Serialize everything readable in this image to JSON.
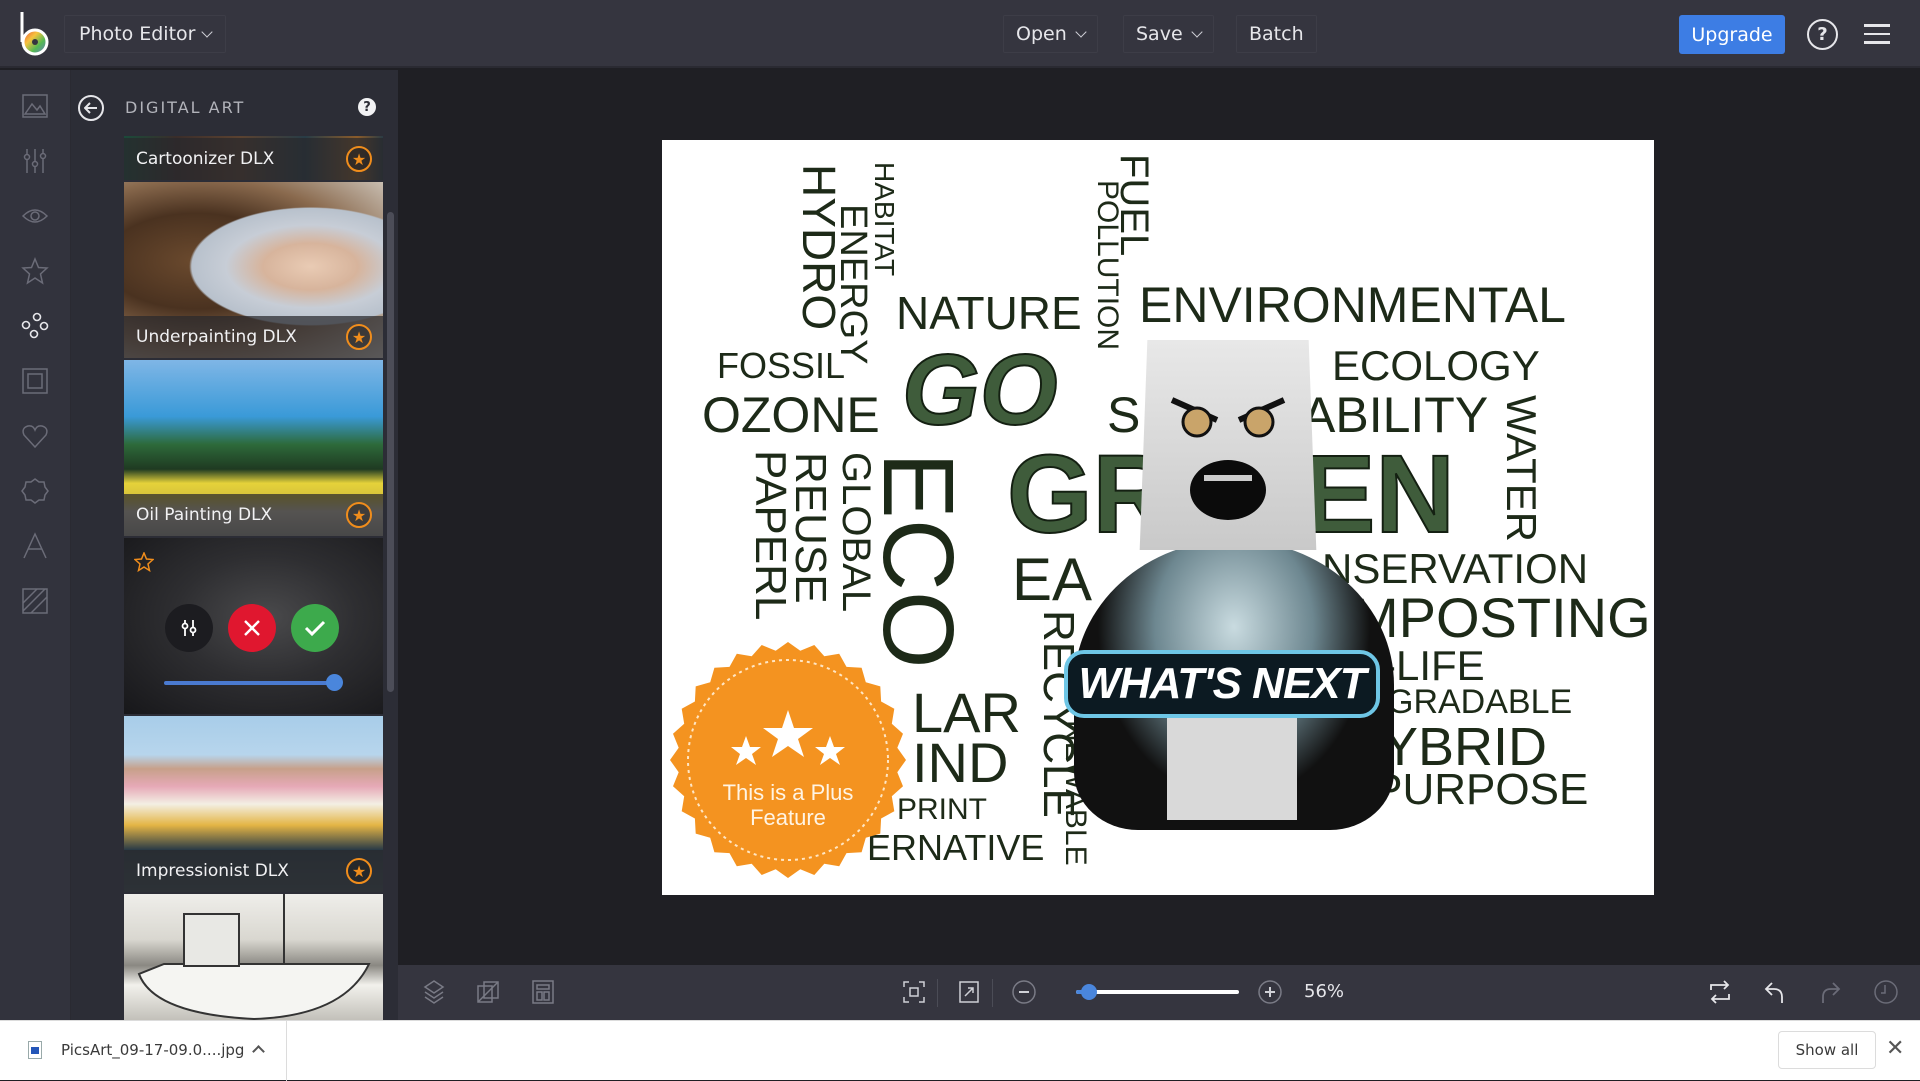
{
  "header": {
    "app_menu_label": "Photo Editor",
    "open_label": "Open",
    "save_label": "Save",
    "batch_label": "Batch",
    "upgrade_label": "Upgrade",
    "help_glyph": "?",
    "accent_color": "#3d7de4"
  },
  "rail": {
    "items": [
      {
        "name": "image-icon",
        "active": false
      },
      {
        "name": "adjust-sliders-icon",
        "active": false
      },
      {
        "name": "eye-icon",
        "active": false
      },
      {
        "name": "star-icon",
        "active": false
      },
      {
        "name": "effects-circles-icon",
        "active": true
      },
      {
        "name": "frame-icon",
        "active": false
      },
      {
        "name": "heart-icon",
        "active": false
      },
      {
        "name": "badge-shape-icon",
        "active": false
      },
      {
        "name": "text-icon",
        "active": false
      },
      {
        "name": "texture-icon",
        "active": false
      }
    ]
  },
  "panel": {
    "title": "DIGITAL ART",
    "help_glyph": "?",
    "effects": [
      {
        "label": "Cartoonizer DLX",
        "premium": true
      },
      {
        "label": "Underpainting DLX",
        "premium": true
      },
      {
        "label": "Oil Painting DLX",
        "premium": true
      },
      {
        "label": "",
        "premium": true,
        "active": true,
        "intensity_percent": 100
      },
      {
        "label": "Impressionist DLX",
        "premium": true
      },
      {
        "label": "",
        "premium": false
      }
    ],
    "premium_color": "#f08d1c",
    "cancel_color": "#e0172f",
    "apply_color": "#3daa4c"
  },
  "canvas": {
    "words": [
      "HYDRO",
      "HABITAT",
      "ENERGY",
      "NATURE",
      "POLLUTION",
      "FUEL",
      "ENVIRONMENTAL",
      "FOSSIL",
      "GO",
      "ECOLOGY",
      "OZONE",
      "S",
      "ABILITY",
      "WATER",
      "PAPERL",
      "REUSE",
      "GLOBAL",
      "ECO",
      "GR",
      "EN",
      "EA",
      "NSERVATION",
      "MPOSTING",
      "RECYCLE",
      "-LIFE",
      "LAR",
      "GRADABLE",
      "IND",
      "YBRID",
      "NEWABLE",
      "REPURPOSE",
      "PRINT",
      "ERNATIVE"
    ],
    "sticker_text": "WHAT'S NEXT",
    "plus_badge_text_line1": "This is a Plus",
    "plus_badge_text_line2": "Feature"
  },
  "bottom_toolbar": {
    "zoom_value": "56%",
    "zoom_fraction": 0.08
  },
  "downloads": {
    "file_name": "PicsArt_09-17-09.0....jpg",
    "show_all_label": "Show all",
    "close_glyph": "✕"
  }
}
